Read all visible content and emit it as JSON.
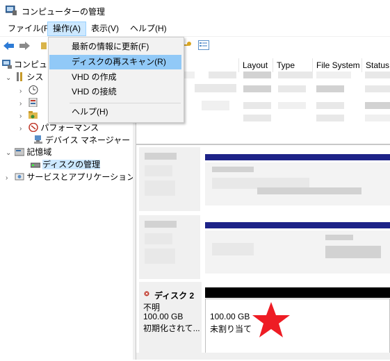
{
  "window": {
    "title": "コンピューターの管理"
  },
  "menubar": {
    "items": [
      {
        "label": "ファイル(F)"
      },
      {
        "label": "操作(A)",
        "active": true
      },
      {
        "label": "表示(V)"
      },
      {
        "label": "ヘルプ(H)"
      }
    ]
  },
  "action_menu": {
    "items": [
      {
        "label": "最新の情報に更新(F)"
      },
      {
        "label": "ディスクの再スキャン(R)",
        "highlighted": true
      },
      {
        "label": "VHD の作成"
      },
      {
        "label": "VHD の接続"
      },
      {
        "label": "ヘルプ(H)"
      }
    ]
  },
  "tree": {
    "root_label": "コンピュ",
    "system_label": "シス",
    "performance_label": "パフォーマンス",
    "device_manager_label": "デバイス マネージャー",
    "storage_label": "記憶域",
    "disk_management_label": "ディスクの管理",
    "services_label": "サービスとアプリケーション"
  },
  "volume_list": {
    "columns": [
      "Layout",
      "Type",
      "File System",
      "Status"
    ]
  },
  "disk2": {
    "title": "ディスク 2",
    "status": "不明",
    "size": "100.00 GB",
    "init_state": "初期化されて...",
    "partition_size": "100.00 GB",
    "partition_state": "未割り当て"
  },
  "colors": {
    "menu_active_bg": "#cce8ff",
    "menu_highlight_bg": "#91c9f7",
    "partition_bar": "#1d2388",
    "annotation_star": "#ee1c24"
  }
}
